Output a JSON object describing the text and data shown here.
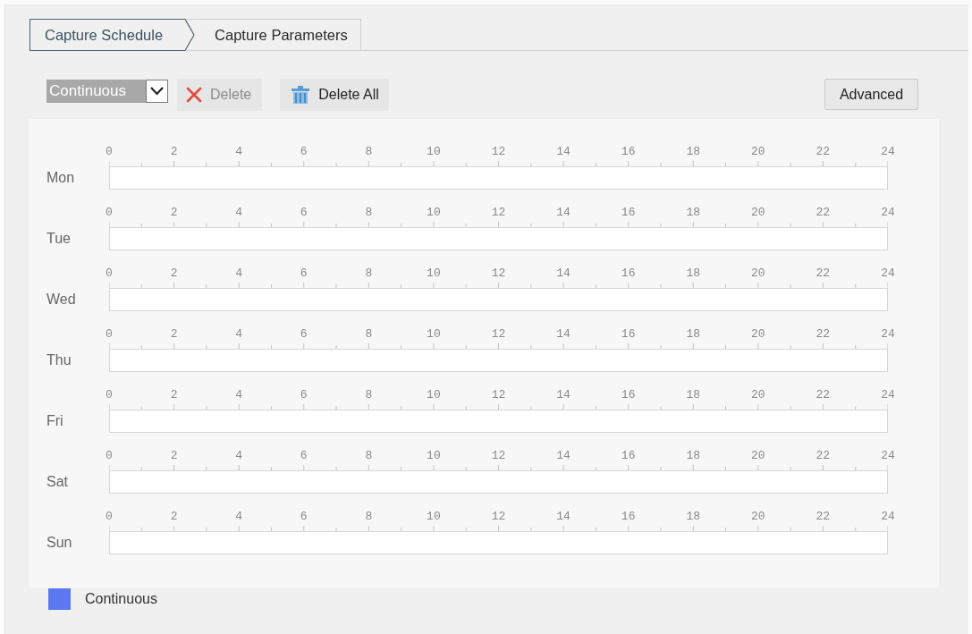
{
  "tabs": [
    {
      "label": "Capture Schedule",
      "selected": true
    },
    {
      "label": "Capture Parameters",
      "selected": false
    }
  ],
  "toolbar": {
    "schedule_type_select": {
      "value": "Continuous"
    },
    "buttons": [
      {
        "kind": "delete",
        "label": "Delete",
        "disabled": true
      },
      {
        "kind": "delete_all",
        "label": "Delete All",
        "disabled": false
      }
    ],
    "advanced_button": {
      "label": "Advanced"
    }
  },
  "schedule": {
    "days": [
      {
        "day": "Mon",
        "hour_labels": [
          "0",
          "2",
          "4",
          "6",
          "8",
          "10",
          "12",
          "14",
          "16",
          "18",
          "20",
          "22",
          "24"
        ]
      },
      {
        "day": "Tue",
        "hour_labels": [
          "0",
          "2",
          "4",
          "6",
          "8",
          "10",
          "12",
          "14",
          "16",
          "18",
          "20",
          "22",
          "24"
        ]
      },
      {
        "day": "Wed",
        "hour_labels": [
          "0",
          "2",
          "4",
          "6",
          "8",
          "10",
          "12",
          "14",
          "16",
          "18",
          "20",
          "22",
          "24"
        ]
      },
      {
        "day": "Thu",
        "hour_labels": [
          "0",
          "2",
          "4",
          "6",
          "8",
          "10",
          "12",
          "14",
          "16",
          "18",
          "20",
          "22",
          "24"
        ]
      },
      {
        "day": "Fri",
        "hour_labels": [
          "0",
          "2",
          "4",
          "6",
          "8",
          "10",
          "12",
          "14",
          "16",
          "18",
          "20",
          "22",
          "24"
        ]
      },
      {
        "day": "Sat",
        "hour_labels": [
          "0",
          "2",
          "4",
          "6",
          "8",
          "10",
          "12",
          "14",
          "16",
          "18",
          "20",
          "22",
          "24"
        ]
      },
      {
        "day": "Sun",
        "hour_labels": [
          "0",
          "2",
          "4",
          "6",
          "8",
          "10",
          "12",
          "14",
          "16",
          "18",
          "20",
          "22",
          "24"
        ]
      }
    ]
  },
  "legend": [
    {
      "label": "Continuous",
      "color": "#5b78f0"
    }
  ]
}
